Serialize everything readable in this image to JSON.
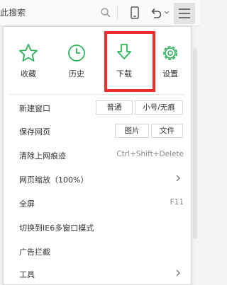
{
  "toolbar": {
    "search_text": "此搜索",
    "icons": [
      "search-icon",
      "mobile-icon",
      "undo-icon",
      "menu-icon"
    ],
    "accent_color": "#2fb35a"
  },
  "quick_actions": [
    {
      "name": "favorites",
      "label": "收藏",
      "icon": "star-icon"
    },
    {
      "name": "history",
      "label": "历史",
      "icon": "clock-icon"
    },
    {
      "name": "download",
      "label": "下载",
      "icon": "download-icon"
    },
    {
      "name": "settings",
      "label": "设置",
      "icon": "gear-icon"
    }
  ],
  "menu": {
    "new_window": {
      "label": "新建窗口",
      "normal": "普通",
      "private": "小号/无痕"
    },
    "save_page": {
      "label": "保存网页",
      "image": "图片",
      "file": "文件"
    },
    "clear_traces": {
      "label": "清除上网痕迹",
      "shortcut": "Ctrl+Shift+Delete"
    },
    "zoom": {
      "label": "网页缩放（100%）"
    },
    "fullscreen": {
      "label": "全屏",
      "shortcut": "F11"
    },
    "ie6_mode": {
      "label": "切换到IE6多窗口模式"
    },
    "ad_block": {
      "label": "广告拦截"
    },
    "tools": {
      "label": "工具"
    }
  },
  "highlight_color": "#ee2c2c"
}
